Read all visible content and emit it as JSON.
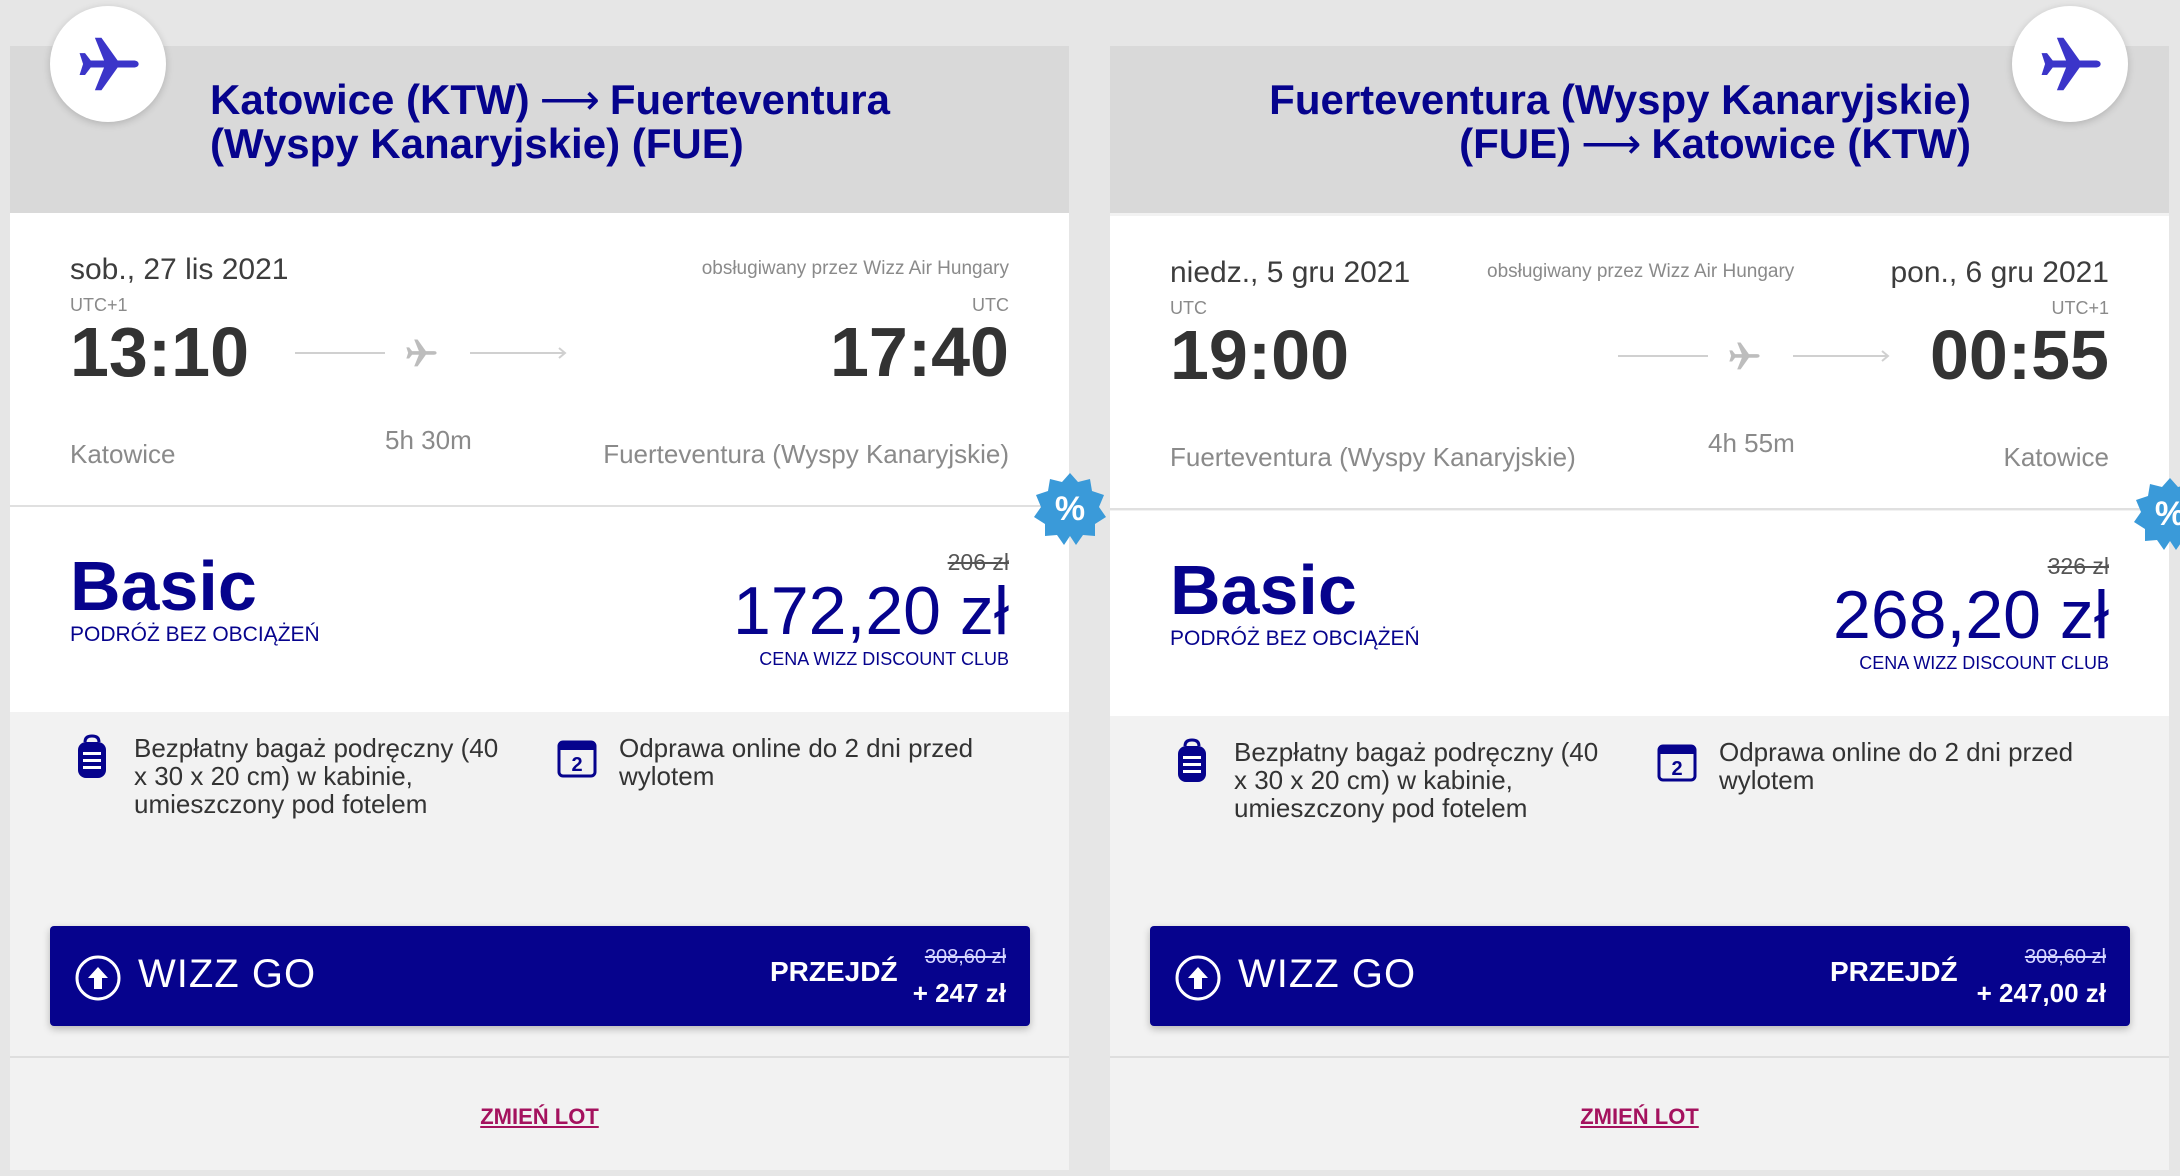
{
  "colors": {
    "brand": "#06038d",
    "accent": "#a4125e",
    "discount": "#3a9ad9"
  },
  "flights": [
    {
      "route_line1": "Katowice (KTW)",
      "route_line1_dest": "Fuerteventura",
      "route_line2": "(Wyspy Kanaryjskie) (FUE)",
      "departure": {
        "date": "sob., 27 lis 2021",
        "tz": "UTC+1",
        "time": "13:10",
        "city": "Katowice"
      },
      "arrival": {
        "date": "",
        "tz": "UTC",
        "time": "17:40",
        "city": "Fuerteventura (Wyspy Kanaryjskie)"
      },
      "operated_by": "obsługiwany przez Wizz Air Hungary",
      "duration": "5h 30m",
      "fare": {
        "name": "Basic",
        "subtitle": "PODRÓŻ BEZ OBCIĄŻEŃ",
        "old_price": "206 zł",
        "price": "172,20 zł",
        "price_label": "CENA WIZZ DISCOUNT CLUB"
      },
      "benefits": {
        "bag": "Bezpłatny bagaż podręczny (40 x 30 x 20 cm) w kabinie, umieszczony pod fotelem",
        "checkin": "Odprawa online do 2 dni przed wylotem",
        "checkin_icon_number": "2"
      },
      "upsell": {
        "name": "WIZZ GO",
        "cta": "PRZEJDŹ",
        "old_price": "308,60 zł",
        "add_price": "+ 247 zł"
      },
      "change_link": "ZMIEŃ LOT"
    },
    {
      "route_line1": "Fuerteventura (Wyspy Kanaryjskie)",
      "route_line2_origin": "(FUE)",
      "route_line2": "Katowice (KTW)",
      "departure": {
        "date": "niedz., 5 gru 2021",
        "tz": "UTC",
        "time": "19:00",
        "city": "Fuerteventura (Wyspy Kanaryjskie)"
      },
      "arrival": {
        "date": "pon., 6 gru 2021",
        "tz": "UTC+1",
        "time": "00:55",
        "city": "Katowice"
      },
      "operated_by": "obsługiwany przez Wizz Air Hungary",
      "duration": "4h 55m",
      "fare": {
        "name": "Basic",
        "subtitle": "PODRÓŻ BEZ OBCIĄŻEŃ",
        "old_price": "326 zł",
        "price": "268,20 zł",
        "price_label": "CENA WIZZ DISCOUNT CLUB"
      },
      "benefits": {
        "bag": "Bezpłatny bagaż podręczny (40 x 30 x 20 cm) w kabinie, umieszczony pod fotelem",
        "checkin": "Odprawa online do 2 dni przed wylotem",
        "checkin_icon_number": "2"
      },
      "upsell": {
        "name": "WIZZ GO",
        "cta": "PRZEJDŹ",
        "old_price": "308,60 zł",
        "add_price": "+ 247,00 zł"
      },
      "change_link": "ZMIEŃ LOT"
    }
  ],
  "icons": {
    "badge": "plane-icon",
    "flight_path": "plane-small-icon",
    "discount": "percent-badge-icon",
    "bag": "backpack-icon",
    "checkin": "calendar-icon",
    "upsell": "arrow-up-circle-icon"
  }
}
